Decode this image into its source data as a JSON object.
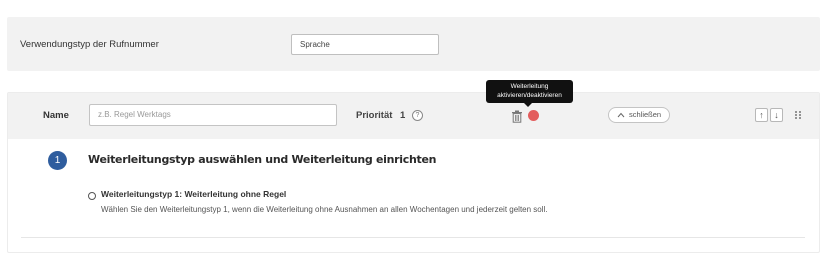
{
  "usage": {
    "label": "Verwendungstyp der Rufnummer",
    "value": "Sprache"
  },
  "rule": {
    "name_label": "Name",
    "name_placeholder": "z.B. Regel Werktags",
    "priority_label": "Priorität",
    "priority_value": "1",
    "help_glyph": "?",
    "close_label": "schließen",
    "up_glyph": "↑",
    "down_glyph": "↓",
    "toggle_color": "#e35d5d"
  },
  "tooltip": {
    "line1": "Weiterleitung",
    "line2": "aktivieren/deaktivieren"
  },
  "step": {
    "number": "1",
    "title": "Weiterleitungstyp auswählen und Weiterleitung einrichten"
  },
  "option": {
    "title": "Weiterleitungstyp 1: Weiterleitung ohne Regel",
    "description": "Wählen Sie den Weiterleitungstyp 1, wenn die Weiterleitung ohne Ausnahmen an allen Wochentagen und jederzeit gelten soll."
  },
  "colors": {
    "accent": "#2f5d9e",
    "panel_bg": "#f2f2f2"
  }
}
